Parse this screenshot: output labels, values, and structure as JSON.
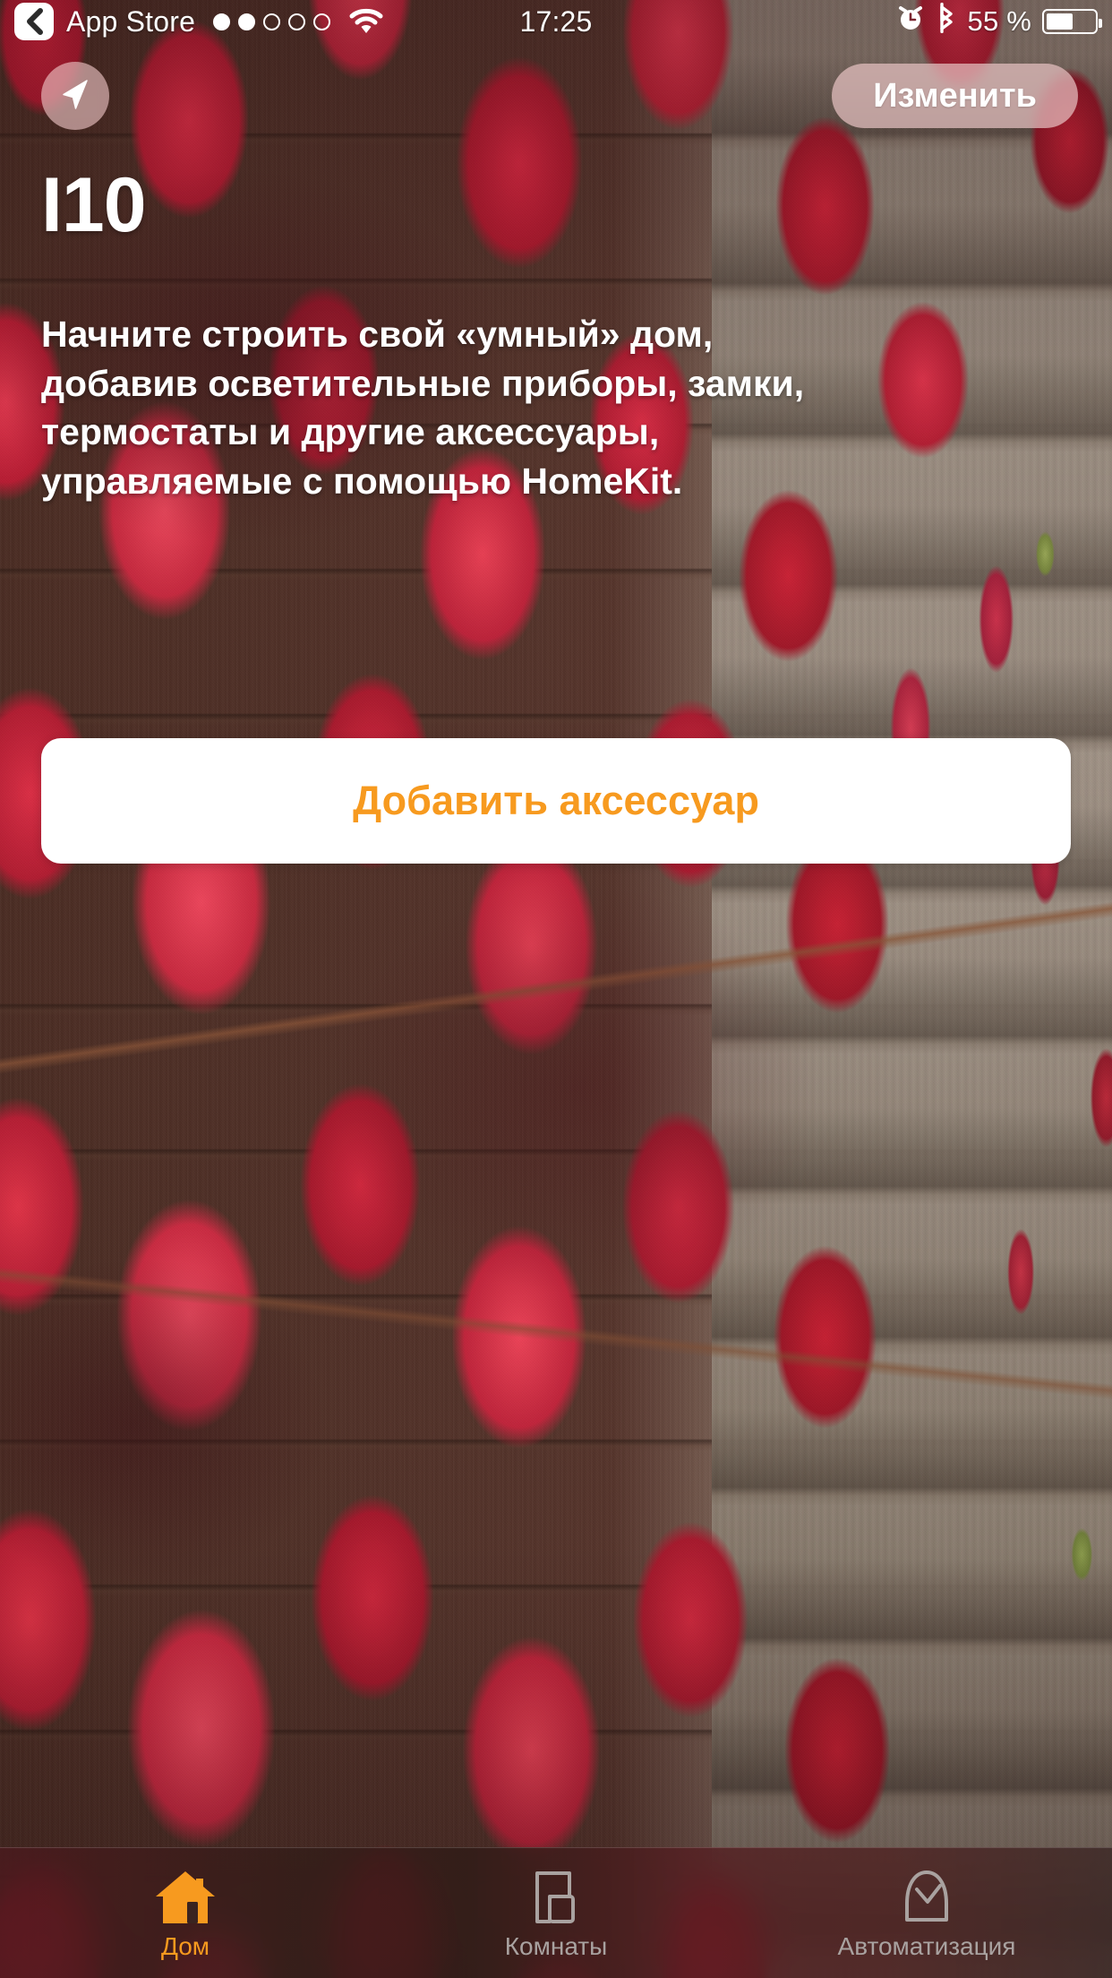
{
  "status_bar": {
    "back_label": "App Store",
    "back_icon": "chevron-left-icon",
    "signal_dots_total": 5,
    "signal_dots_filled": 2,
    "wifi_icon": "wifi-icon",
    "time": "17:25",
    "alarm_icon": "alarm-clock-icon",
    "bluetooth_icon": "bluetooth-icon",
    "battery_percent_label": "55 %",
    "battery_level": 55,
    "battery_icon": "battery-icon"
  },
  "header": {
    "location_button_icon": "location-arrow-icon",
    "edit_label": "Изменить"
  },
  "hero": {
    "home_name": "I10",
    "intro_lines": [
      "Начните строить свой «умный» дом,",
      "добавив осветительные приборы, замки,",
      "термостаты и другие аксессуары,",
      "управляемые с помощью HomeKit."
    ]
  },
  "primary_action": {
    "label": "Добавить аксессуар",
    "text_color": "#F79A1F",
    "background": "#FFFFFF"
  },
  "tab_bar": {
    "active_color": "#F79A1F",
    "inactive_color": "#A9A2A0",
    "items": [
      {
        "label": "Дом",
        "icon": "house-filled-icon",
        "active": true
      },
      {
        "label": "Комнаты",
        "icon": "rooms-outline-icon",
        "active": false
      },
      {
        "label": "Автоматизация",
        "icon": "clock-outline-icon",
        "active": false
      }
    ]
  },
  "theme": {
    "accent": "#F79A1F",
    "background_description": "red-vine-leaves-on-wooden-wall"
  }
}
